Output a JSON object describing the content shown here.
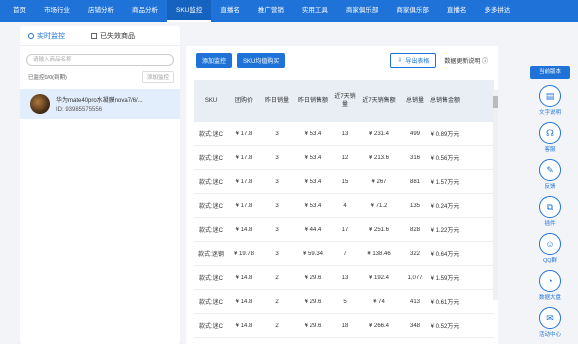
{
  "nav": {
    "items": [
      "首页",
      "市场行业",
      "店铺分析",
      "商品分析",
      "SKU监控",
      "直播名",
      "推广营销",
      "实用工具",
      "商家俱乐部",
      "商家俱乐部",
      "直播名",
      "多多拼达"
    ],
    "active_index": 4
  },
  "left": {
    "tab_realtime": "实时监控",
    "tab_invalid": "已失效商品",
    "search_placeholder": "请输入商品名称",
    "count_text": "已监控0/0(到期)",
    "add_button": "添加监控",
    "product_name": "华为mate40pro水凝膜nova7/6/...",
    "product_id": "ID: 93985575556"
  },
  "main": {
    "add_monitor": "添加监控",
    "sku_compare": "SKU均值购买",
    "export": "导出表格",
    "data_note": "数据更新说明"
  },
  "table": {
    "headers": [
      "SKU",
      "团购价",
      "昨日销量",
      "昨日销售额",
      "近7天销量",
      "近7天销售额",
      "总销量",
      "总销售金额"
    ],
    "rows": [
      [
        "款式:迷C",
        "¥ 17.8",
        "3",
        "¥ 53.4",
        "13",
        "¥ 231.4",
        "499",
        "¥ 0.89万元"
      ],
      [
        "款式:迷C",
        "¥ 17.8",
        "3",
        "¥ 53.4",
        "12",
        "¥ 213.6",
        "316",
        "¥ 0.56万元"
      ],
      [
        "款式:迷C",
        "¥ 17.8",
        "3",
        "¥ 53.4",
        "15",
        "¥ 267",
        "881",
        "¥ 1.57万元"
      ],
      [
        "款式:迷C",
        "¥ 17.8",
        "3",
        "¥ 53.4",
        "4",
        "¥ 71.2",
        "135",
        "¥ 0.24万元"
      ],
      [
        "款式:迷C",
        "¥ 14.8",
        "3",
        "¥ 44.4",
        "17",
        "¥ 251.6",
        "828",
        "¥ 1.22万元"
      ],
      [
        "款式:迷钢",
        "¥ 19.78",
        "3",
        "¥ 59.34",
        "7",
        "¥ 138.46",
        "322",
        "¥ 0.64万元"
      ],
      [
        "款式:迷C",
        "¥ 14.8",
        "2",
        "¥ 29.6",
        "13",
        "¥ 192.4",
        "1,077",
        "¥ 1.59万元"
      ],
      [
        "款式:迷C",
        "¥ 14.8",
        "2",
        "¥ 29.6",
        "5",
        "¥ 74",
        "413",
        "¥ 0.61万元"
      ],
      [
        "款式:迷C",
        "¥ 14.8",
        "2",
        "¥ 29.6",
        "18",
        "¥ 266.4",
        "348",
        "¥ 0.52万元"
      ]
    ]
  },
  "rightbar": {
    "top_label": "当前版本",
    "items": [
      {
        "label": "文字说明",
        "icon": "doc-icon"
      },
      {
        "label": "客服",
        "icon": "headset-icon"
      },
      {
        "label": "反馈",
        "icon": "feedback-icon"
      },
      {
        "label": "插件",
        "icon": "plugin-icon"
      },
      {
        "label": "QQ群",
        "icon": "qq-icon"
      },
      {
        "label": "数据大盘",
        "icon": "chart-icon"
      },
      {
        "label": "活动中心",
        "icon": "gift-icon"
      }
    ]
  }
}
